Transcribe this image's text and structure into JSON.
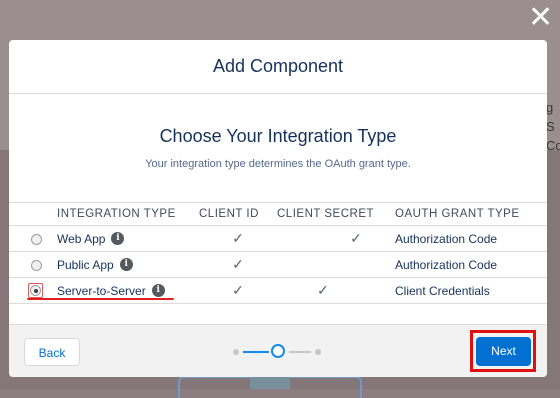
{
  "modal": {
    "title": "Add Component",
    "section_title": "Choose Your Integration Type",
    "section_subtitle": "Your integration type determines the OAuth grant type."
  },
  "table": {
    "headers": [
      "INTEGRATION TYPE",
      "CLIENT ID",
      "CLIENT SECRET",
      "OAUTH GRANT TYPE"
    ],
    "rows": [
      {
        "type": "Web App",
        "client_id": true,
        "client_secret": true,
        "grant": "Authorization Code",
        "selected": false
      },
      {
        "type": "Public App",
        "client_id": true,
        "client_secret": false,
        "grant": "Authorization Code",
        "selected": false
      },
      {
        "type": "Server-to-Server",
        "client_id": true,
        "client_secret": true,
        "grant": "Client Credentials",
        "selected": true
      }
    ],
    "check_glyph": "✓",
    "info_glyph": "i"
  },
  "footer": {
    "back_label": "Back",
    "next_label": "Next",
    "progress": {
      "current_step": 2,
      "total_steps": 3
    }
  },
  "close_glyph": "✕",
  "background": {
    "peek_text_line1": "g S",
    "peek_text_line2": "Cq"
  },
  "colors": {
    "primary": "#0070d2",
    "progress_active": "#1589ee",
    "annotation_red": "#e01010",
    "title_text": "#16325c"
  }
}
